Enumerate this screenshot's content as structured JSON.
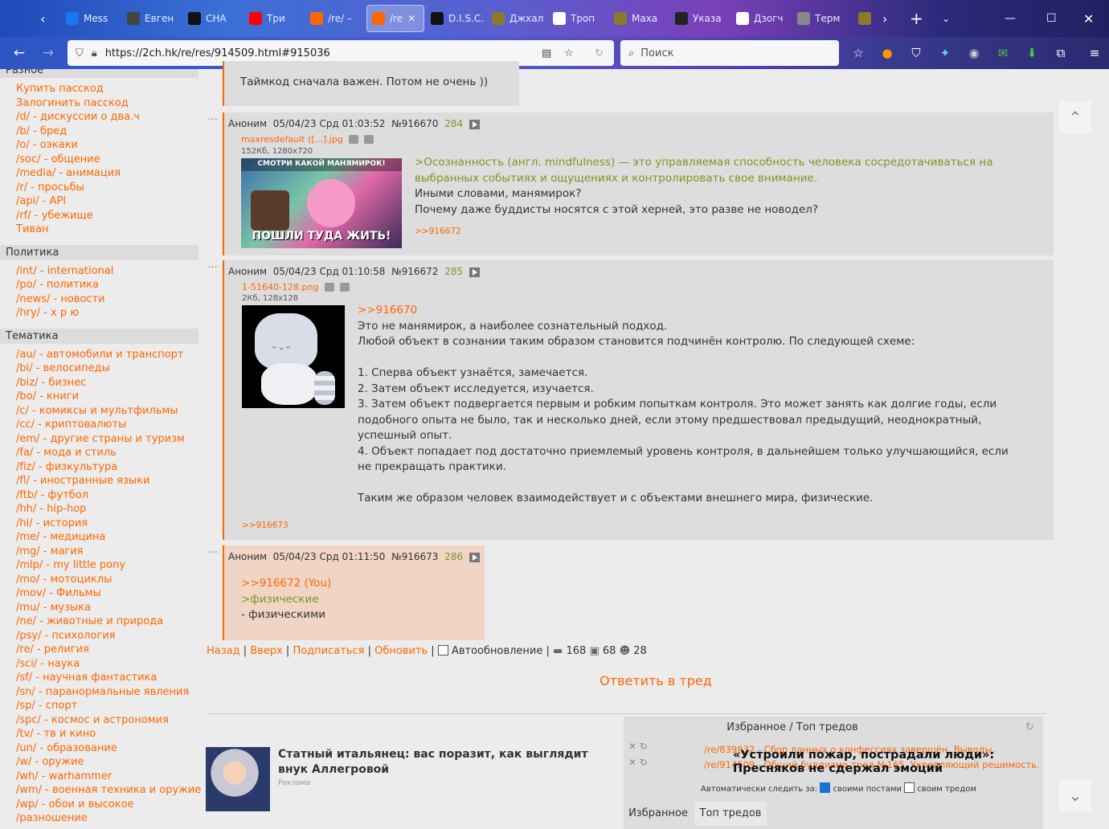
{
  "browser": {
    "tabs": [
      {
        "title": "Mess",
        "icon": "messenger-icon",
        "color": "#1877f2"
      },
      {
        "title": "Евген",
        "icon": "chess-icon",
        "color": "#444444"
      },
      {
        "title": "СНА",
        "icon": "star-icon",
        "color": "#111111"
      },
      {
        "title": "Три",
        "icon": "youtube-icon",
        "color": "#ff0000"
      },
      {
        "title": "/re/ –",
        "icon": "dvach-icon",
        "color": "#ff6600"
      },
      {
        "title": "/re",
        "icon": "dvach-icon",
        "color": "#ff6600",
        "active": true
      },
      {
        "title": "D.I.S.C. воспр",
        "icon": "play-icon",
        "color": "#111111"
      },
      {
        "title": "Джхал",
        "icon": "dharma-wheel-icon",
        "color": "#8a7a2a"
      },
      {
        "title": "Троп",
        "icon": "wikipedia-icon",
        "color": "#ffffff"
      },
      {
        "title": "Маха",
        "icon": "dharma-wheel-icon",
        "color": "#8a7a2a"
      },
      {
        "title": "Указа",
        "icon": "dharma-wheel-icon",
        "color": "#222222"
      },
      {
        "title": "Дзогч",
        "icon": "wikipedia-icon",
        "color": "#ffffff"
      },
      {
        "title": "Терм",
        "icon": "meditation-icon",
        "color": "#888888"
      },
      {
        "title": "",
        "icon": "dharma-wheel-icon",
        "color": "#8a7a2a"
      }
    ],
    "url": "https://2ch.hk/re/res/914509.html#915036",
    "search_placeholder": "Поиск"
  },
  "sidebar": {
    "sections": [
      {
        "title": "Разное",
        "items": [
          "Купить пасскод",
          "Залогинить пасскод",
          "/d/ - дискуссии о два.ч",
          "/b/ - бред",
          "/o/ - оэкаки",
          "/soc/ - общение",
          "/media/ - анимация",
          "/r/ - просьбы",
          "/api/ - API",
          "/rf/ - убежище",
          "Тиван"
        ]
      },
      {
        "title": "Политика",
        "items": [
          "/int/ - international",
          "/po/ - политика",
          "/news/ - новости",
          "/hry/ - х р ю"
        ]
      },
      {
        "title": "Тематика",
        "items": [
          "/au/ - автомобили и транспорт",
          "/bi/ - велосипеды",
          "/biz/ - бизнес",
          "/bo/ - книги",
          "/c/ - комиксы и мультфильмы",
          "/cc/ - криптовалюты",
          "/em/ - другие страны и туризм",
          "/fa/ - мода и стиль",
          "/fiz/ - физкультура",
          "/fl/ - иностранные языки",
          "/ftb/ - футбол",
          "/hh/ - hip-hop",
          "/hi/ - история",
          "/me/ - медицина",
          "/mg/ - магия",
          "/mlp/ - my little pony",
          "/mo/ - мотоциклы",
          "/mov/ - Фильмы",
          "/mu/ - музыка",
          "/ne/ - животные и природа",
          "/psy/ - психология",
          "/re/ - религия",
          "/sci/ - наука",
          "/sf/ - научная фантастика",
          "/sn/ - паранормальные явления",
          "/sp/ - спорт",
          "/spc/ - космос и астрономия",
          "/tv/ - тв и кино",
          "/un/ - образование",
          "/w/ - оружие",
          "/wh/ - warhammer",
          "/wm/ - военная техника и оружие",
          "/wp/ - обои и высокое",
          "/разношение"
        ]
      }
    ]
  },
  "posts": {
    "top_fragment": "Таймкод сначала важен. Потом не очень ))",
    "p1": {
      "author": "Аноним",
      "date": "05/04/23 Срд 01:03:52",
      "id": "№916670",
      "count": "284",
      "file_name": "maxresdefault ([...].jpg",
      "file_meta": "152Кб, 1280x720",
      "thumb_top": "СМОТРИ КАКОЙ МАНЯМИРОК!",
      "thumb_bottom": "ПОШЛИ ТУДА ЖИТЬ!",
      "quote": ">Осознанность (англ. mindfulness) — это управляемая способность человека сосредотачиваться на выбранных событиях и ощущениях и контролировать свое внимание.",
      "line1": "Иными словами, манямирок?",
      "line2": "Почему даже буддисты носятся с этой херней, это разве не новодел?",
      "backlink": ">>916672"
    },
    "p2": {
      "author": "Аноним",
      "date": "05/04/23 Срд 01:10:58",
      "id": "№916672",
      "count": "285",
      "file_name": "1-51640-128.png",
      "file_meta": "2Кб, 128x128",
      "reply": ">>916670",
      "l1": "Это не манямирок, а наиболее сознательный подход.",
      "l2": "Любой объект в сознании таким образом становится подчинён контролю. По следующей схеме:",
      "l3": "1. Сперва объект узнаётся, замечается.",
      "l4": "2. Затем объект исследуется, изучается.",
      "l5": "3. Затем объект подвергается первым и робким попыткам контроля. Это может занять как долгие годы, если подобного опыта не было, так и несколько дней, если этому предшествовал предыдущий, неоднократный, успешный опыт.",
      "l6": "4. Объект попадает под достаточно приемлемый уровень контроля, в дальнейшем только улучшающийся, если не прекращать практики.",
      "l7": "Таким же образом человек взаимодействует и с объектами внешнего мира, физические.",
      "backlink": ">>916673"
    },
    "p3": {
      "author": "Аноним",
      "date": "05/04/23 Срд 01:11:50",
      "id": "№916673",
      "count": "286",
      "reply": ">>916672 (You)",
      "quote": ">физические",
      "line": "- физическими"
    }
  },
  "thread_nav": {
    "back": "Назад",
    "top": "Вверх",
    "subscribe": "Подписаться",
    "refresh": "Обновить",
    "autorefresh": "Автообновление",
    "posts": "168",
    "files": "68",
    "users": "28",
    "reply_button": "Ответить в тред"
  },
  "ad": {
    "title": "Статный итальянец: вас поразит, как выглядит внук Аллегровой",
    "label": "Реклама"
  },
  "favorites": {
    "header": "Избранное / Топ тредов",
    "rows": [
      "/re/839832 - Сбор данных о конфессиях завершён. Выводы.",
      "/re/914509 - Общий буддизма тред №165. Укрепляющий решимость."
    ],
    "overlay_headline": "«Устроили пожар, пострадали люди»: Пресняков не сдержал эмоций",
    "auto_label": "Автоматически следить за:",
    "opt1": "своими постами",
    "opt2": "своим тредом",
    "tab1": "Избранное",
    "tab2": "Топ тредов"
  },
  "colors": {
    "accent": "#ff6600",
    "quote": "#789922",
    "post_bg": "#dddddd",
    "own_post_bg": "#f0d5c5"
  }
}
